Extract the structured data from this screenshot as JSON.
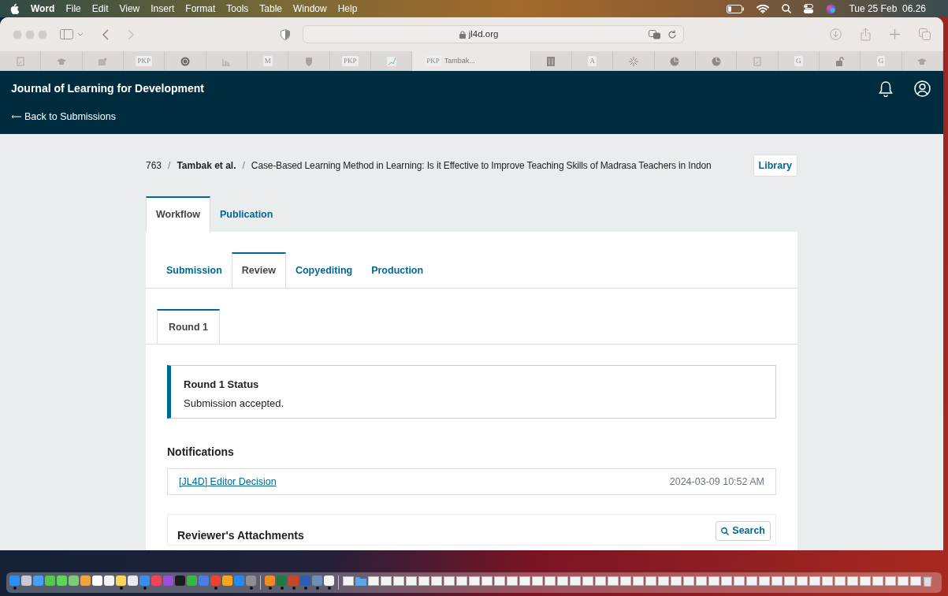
{
  "menu_bar": {
    "app": "Word",
    "menus": [
      "File",
      "Edit",
      "View",
      "Insert",
      "Format",
      "Tools",
      "Table",
      "Window",
      "Help"
    ],
    "clock": "Tue 25 Feb  06.26"
  },
  "browser": {
    "address": "jl4d.org",
    "tabs": [
      {
        "kind": "doc",
        "selected": false
      },
      {
        "kind": "hat",
        "selected": false
      },
      {
        "kind": "image",
        "selected": false
      },
      {
        "kind": "text",
        "favicon": "PKP",
        "selected": false
      },
      {
        "kind": "circle",
        "selected": false
      },
      {
        "kind": "chart",
        "selected": false
      },
      {
        "kind": "text",
        "favicon": "M",
        "selected": false
      },
      {
        "kind": "shield",
        "selected": false
      },
      {
        "kind": "text",
        "favicon": "PKP",
        "selected": false
      },
      {
        "kind": "logo",
        "selected": false
      },
      {
        "kind": "text",
        "favicon": "PKP",
        "label": "Tambak...",
        "selected": true
      },
      {
        "kind": "book",
        "selected": false
      },
      {
        "kind": "text",
        "favicon": "A",
        "selected": false
      },
      {
        "kind": "burst",
        "selected": false
      },
      {
        "kind": "pie",
        "selected": false
      },
      {
        "kind": "pie",
        "selected": false
      },
      {
        "kind": "doc",
        "selected": false
      },
      {
        "kind": "text",
        "favicon": "G",
        "selected": false
      },
      {
        "kind": "lock",
        "selected": false
      },
      {
        "kind": "text",
        "favicon": "G",
        "selected": false
      },
      {
        "kind": "hat",
        "selected": false
      }
    ]
  },
  "site": {
    "journal": "Journal of Learning for Development",
    "back": "Back to Submissions"
  },
  "breadcrumb": {
    "id": "763",
    "separators": [
      "/",
      "/"
    ],
    "author": "Tambak et al.",
    "title": "Case-Based Learning Method in Learning: Is it Effective to Improve Teaching Skills of Madrasa Teachers in Indon",
    "library": "Library"
  },
  "tabs": [
    {
      "label": "Workflow",
      "selected": true
    },
    {
      "label": "Publication",
      "selected": false
    }
  ],
  "stages": [
    {
      "label": "Submission",
      "selected": false
    },
    {
      "label": "Review",
      "selected": true
    },
    {
      "label": "Copyediting",
      "selected": false
    },
    {
      "label": "Production",
      "selected": false
    }
  ],
  "rounds": [
    {
      "label": "Round 1",
      "selected": true
    }
  ],
  "status": {
    "title": "Round 1 Status",
    "message": "Submission accepted."
  },
  "notifications": {
    "title": "Notifications",
    "rows": [
      {
        "link": "[JL4D] Editor Decision",
        "date": "2024-03-09 10:52 AM"
      }
    ]
  },
  "attachments": {
    "title": "Reviewer's Attachments",
    "search": "Search"
  },
  "dock": {
    "items": [
      {
        "kind": "app",
        "color": "#2f8ff0",
        "running": true
      },
      {
        "kind": "app",
        "color": "#c9c9d6",
        "running": false
      },
      {
        "kind": "app",
        "color": "#4a9ef5",
        "running": false
      },
      {
        "kind": "app",
        "color": "#54c84a",
        "running": false
      },
      {
        "kind": "app",
        "color": "#5fd35a",
        "running": false
      },
      {
        "kind": "app",
        "color": "#7fc97a",
        "running": false
      },
      {
        "kind": "app",
        "color": "#f4a341",
        "running": false
      },
      {
        "kind": "app",
        "color": "#ffffff",
        "running": false
      },
      {
        "kind": "app",
        "color": "#f2f2f2",
        "running": false
      },
      {
        "kind": "app",
        "color": "#f7d65a",
        "running": true
      },
      {
        "kind": "app",
        "color": "#e8e8f0",
        "running": false
      },
      {
        "kind": "app",
        "color": "#3a8ef2",
        "running": true
      },
      {
        "kind": "app",
        "color": "#f0445a",
        "running": false
      },
      {
        "kind": "app",
        "color": "#9a4fd8",
        "running": false
      },
      {
        "kind": "app",
        "color": "#1c1c1e",
        "running": false
      },
      {
        "kind": "app",
        "color": "#3bb54a",
        "running": false
      },
      {
        "kind": "app",
        "color": "#4a7de0",
        "running": false
      },
      {
        "kind": "app",
        "color": "#e94335",
        "running": true
      },
      {
        "kind": "app",
        "color": "#f5a623",
        "running": false
      },
      {
        "kind": "app",
        "color": "#1d8cf5",
        "running": false
      },
      {
        "kind": "app",
        "color": "#8e8e93",
        "running": true
      },
      {
        "kind": "separator"
      },
      {
        "kind": "app",
        "color": "#f08a24",
        "running": true
      },
      {
        "kind": "app",
        "color": "#1f7a44",
        "running": true
      },
      {
        "kind": "app",
        "color": "#c8462a",
        "running": true
      },
      {
        "kind": "app",
        "color": "#2b5fb4",
        "running": true
      },
      {
        "kind": "app",
        "color": "#6c8fb8",
        "running": true
      },
      {
        "kind": "app",
        "color": "#f4f4f4",
        "running": true
      },
      {
        "kind": "separator"
      },
      {
        "kind": "doc",
        "running": false
      },
      {
        "kind": "folder",
        "running": false
      },
      {
        "kind": "doc",
        "running": false
      },
      {
        "kind": "doc",
        "running": false
      },
      {
        "kind": "doc",
        "running": false
      },
      {
        "kind": "doc",
        "running": false
      },
      {
        "kind": "doc",
        "running": false
      },
      {
        "kind": "doc",
        "running": false
      },
      {
        "kind": "doc",
        "running": false
      },
      {
        "kind": "doc",
        "running": false
      },
      {
        "kind": "doc",
        "running": false
      },
      {
        "kind": "doc",
        "running": false
      },
      {
        "kind": "doc",
        "running": false
      },
      {
        "kind": "doc",
        "running": false
      },
      {
        "kind": "doc",
        "running": false
      },
      {
        "kind": "doc",
        "running": false
      },
      {
        "kind": "doc",
        "running": false
      },
      {
        "kind": "doc",
        "running": false
      },
      {
        "kind": "doc",
        "running": false
      },
      {
        "kind": "doc",
        "running": false
      },
      {
        "kind": "doc",
        "running": false
      },
      {
        "kind": "doc",
        "running": false
      },
      {
        "kind": "doc",
        "running": false
      },
      {
        "kind": "doc",
        "running": false
      },
      {
        "kind": "doc",
        "running": false
      },
      {
        "kind": "doc",
        "running": false
      },
      {
        "kind": "doc",
        "running": false
      },
      {
        "kind": "doc",
        "running": false
      },
      {
        "kind": "doc",
        "running": false
      },
      {
        "kind": "doc",
        "running": false
      },
      {
        "kind": "doc",
        "running": false
      },
      {
        "kind": "doc",
        "running": false
      },
      {
        "kind": "doc",
        "running": false
      },
      {
        "kind": "doc",
        "running": false
      },
      {
        "kind": "doc",
        "running": false
      },
      {
        "kind": "doc",
        "running": false
      },
      {
        "kind": "doc",
        "running": false
      },
      {
        "kind": "doc",
        "running": false
      },
      {
        "kind": "doc",
        "running": false
      },
      {
        "kind": "doc",
        "running": false
      },
      {
        "kind": "doc",
        "running": false
      },
      {
        "kind": "doc",
        "running": false
      },
      {
        "kind": "doc",
        "running": false
      },
      {
        "kind": "doc",
        "running": false
      },
      {
        "kind": "doc",
        "running": false
      },
      {
        "kind": "doc",
        "running": false
      },
      {
        "kind": "trash",
        "running": false
      }
    ]
  }
}
